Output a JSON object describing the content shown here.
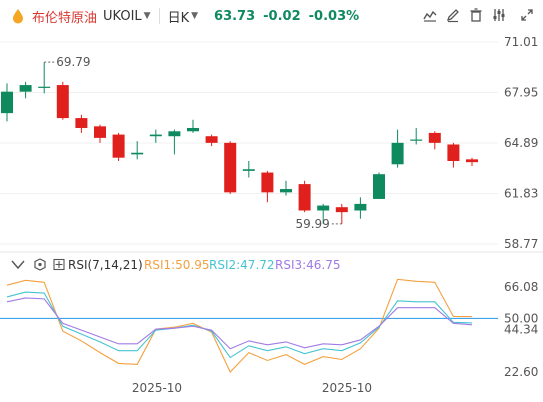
{
  "header": {
    "instrument_name": "布伦特原油",
    "instrument_code": "UKOIL",
    "period": "日K",
    "price": "63.73",
    "change": "-0.02",
    "change_pct": "-0.03%",
    "icons": [
      "chart-style-icon",
      "pen-icon",
      "delete-icon",
      "settings-icon",
      "fullscreen-icon"
    ]
  },
  "colors": {
    "up": "#0f8a5f",
    "down": "#e0201c",
    "price_down_text": "#0f8a5f",
    "axis_text": "#d9382f",
    "rsi1": "#f4a041",
    "rsi2": "#45c3d2",
    "rsi3": "#a17ae6",
    "ref_line": "#3ea3e8",
    "grid": "#f0f0f0"
  },
  "chart_data": [
    {
      "type": "candlestick",
      "y_ticks": [
        "71.01",
        "67.95",
        "64.89",
        "61.83",
        "58.77"
      ],
      "ylim": [
        58.77,
        71.01
      ],
      "x_labels": [
        "2025-10",
        "2025-10"
      ],
      "annotations": {
        "high": "69.79",
        "low": "59.99"
      },
      "candles": [
        {
          "o": 66.7,
          "c": 68.0,
          "h": 68.5,
          "l": 66.2
        },
        {
          "o": 68.0,
          "c": 68.4,
          "h": 68.6,
          "l": 67.6
        },
        {
          "o": 68.3,
          "c": 68.3,
          "h": 69.79,
          "l": 67.9
        },
        {
          "o": 68.4,
          "c": 66.4,
          "h": 68.6,
          "l": 66.3
        },
        {
          "o": 66.4,
          "c": 65.8,
          "h": 66.6,
          "l": 65.5
        },
        {
          "o": 65.9,
          "c": 65.2,
          "h": 66.0,
          "l": 64.9
        },
        {
          "o": 65.4,
          "c": 64.0,
          "h": 65.5,
          "l": 63.8
        },
        {
          "o": 64.2,
          "c": 64.3,
          "h": 65.0,
          "l": 63.9
        },
        {
          "o": 65.3,
          "c": 65.4,
          "h": 65.7,
          "l": 64.9
        },
        {
          "o": 65.3,
          "c": 65.6,
          "h": 65.7,
          "l": 64.2
        },
        {
          "o": 65.6,
          "c": 65.8,
          "h": 66.3,
          "l": 65.5
        },
        {
          "o": 65.3,
          "c": 64.9,
          "h": 65.4,
          "l": 64.7
        },
        {
          "o": 64.9,
          "c": 61.9,
          "h": 65.0,
          "l": 61.8
        },
        {
          "o": 63.2,
          "c": 63.3,
          "h": 63.8,
          "l": 62.8
        },
        {
          "o": 63.1,
          "c": 61.9,
          "h": 63.2,
          "l": 61.3
        },
        {
          "o": 61.9,
          "c": 62.1,
          "h": 62.6,
          "l": 61.7
        },
        {
          "o": 62.4,
          "c": 60.8,
          "h": 62.6,
          "l": 60.7
        },
        {
          "o": 60.8,
          "c": 61.1,
          "h": 61.2,
          "l": 60.0
        },
        {
          "o": 61.0,
          "c": 60.7,
          "h": 61.2,
          "l": 59.99
        },
        {
          "o": 60.8,
          "c": 61.2,
          "h": 61.6,
          "l": 60.3
        },
        {
          "o": 61.5,
          "c": 63.0,
          "h": 63.1,
          "l": 61.5
        },
        {
          "o": 63.6,
          "c": 64.9,
          "h": 65.7,
          "l": 63.4
        },
        {
          "o": 65.1,
          "c": 65.1,
          "h": 65.8,
          "l": 64.8
        },
        {
          "o": 65.5,
          "c": 64.9,
          "h": 65.6,
          "l": 64.5
        },
        {
          "o": 64.8,
          "c": 63.8,
          "h": 64.9,
          "l": 63.4
        },
        {
          "o": 63.9,
          "c": 63.73,
          "h": 64.0,
          "l": 63.5
        }
      ]
    },
    {
      "type": "line",
      "indicator_label": "RSI(7,14,21)",
      "legend": [
        "RSI1:50.95",
        "RSI2:47.72",
        "RSI3:46.75"
      ],
      "y_ticks": [
        "66.08",
        "50.00",
        "44.34",
        "22.60"
      ],
      "ylim": [
        22.6,
        66.08
      ],
      "ref_line": 50.0,
      "series": [
        {
          "name": "RSI1",
          "values": [
            67.0,
            69.5,
            68.5,
            43.5,
            38.5,
            32.5,
            27.0,
            26.5,
            44.5,
            45.5,
            47.5,
            43.0,
            22.6,
            32.5,
            28.5,
            31.5,
            26.5,
            30.5,
            29.0,
            34.5,
            45.0,
            70.0,
            69.0,
            68.5,
            51.0,
            50.95
          ]
        },
        {
          "name": "RSI2",
          "values": [
            61.0,
            63.5,
            63.0,
            46.0,
            42.0,
            38.0,
            33.5,
            33.5,
            44.0,
            45.0,
            46.5,
            43.5,
            30.0,
            36.0,
            33.5,
            35.5,
            32.0,
            34.5,
            33.5,
            37.5,
            45.5,
            59.0,
            58.5,
            58.5,
            48.0,
            47.72
          ]
        },
        {
          "name": "RSI3",
          "values": [
            58.5,
            60.5,
            60.0,
            47.5,
            44.0,
            40.5,
            37.0,
            37.0,
            44.5,
            45.0,
            46.0,
            44.0,
            34.5,
            38.5,
            36.5,
            38.0,
            35.0,
            37.0,
            36.5,
            39.0,
            46.0,
            55.5,
            55.5,
            55.5,
            47.5,
            46.75
          ]
        }
      ]
    }
  ]
}
